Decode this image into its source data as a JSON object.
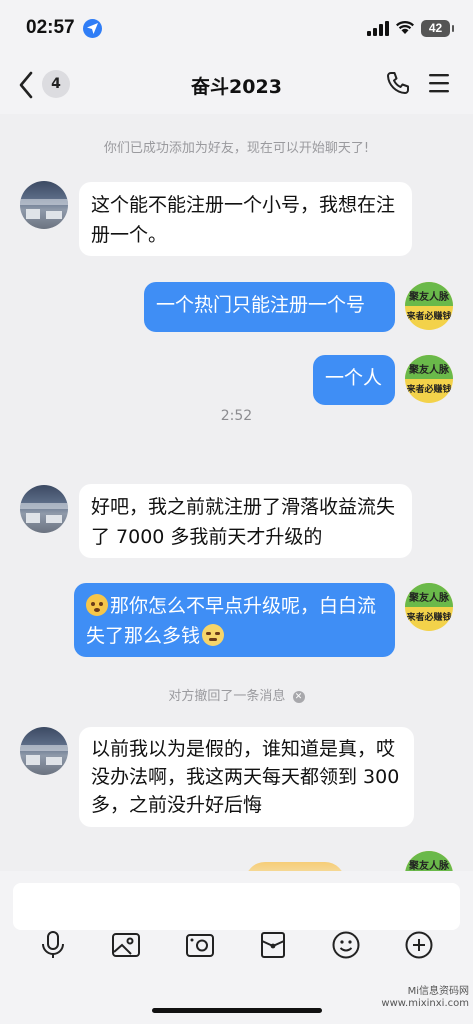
{
  "status": {
    "time": "02:57",
    "battery": "42"
  },
  "header": {
    "unread_count": "4",
    "title": "奋斗2023"
  },
  "brand_avatar": {
    "line1": "聚友人脉",
    "line2": "来者必赚钱"
  },
  "chat": {
    "system_added": "你们已成功添加为好友，现在可以开始聊天了!",
    "timestamp": "2:52",
    "recall_notice": "对方撤回了一条消息",
    "messages": [
      {
        "side": "left",
        "text": "这个能不能注册一个小号，我想在注册一个。"
      },
      {
        "side": "right",
        "text": "一个热门只能注册一个号"
      },
      {
        "side": "right",
        "text": "一个人"
      },
      {
        "side": "left",
        "text": "好吧，我之前就注册了滑落收益流失了 7000 多我前天才升级的"
      },
      {
        "side": "right",
        "text": "那你怎么不早点升级呢，白白流失了那么多钱"
      },
      {
        "side": "left",
        "text": "以前我以为是假的，谁知道是真，哎没办法啊，我这两天每天都领到 300 多，之前没升好后悔"
      }
    ]
  },
  "toolbar": {
    "icons": [
      "microphone-icon",
      "image-icon",
      "camera-icon",
      "red-packet-icon",
      "emoji-icon",
      "plus-icon"
    ]
  },
  "watermark": {
    "line1": "Mi信息资码网",
    "line2": "www.mixinxi.com"
  }
}
